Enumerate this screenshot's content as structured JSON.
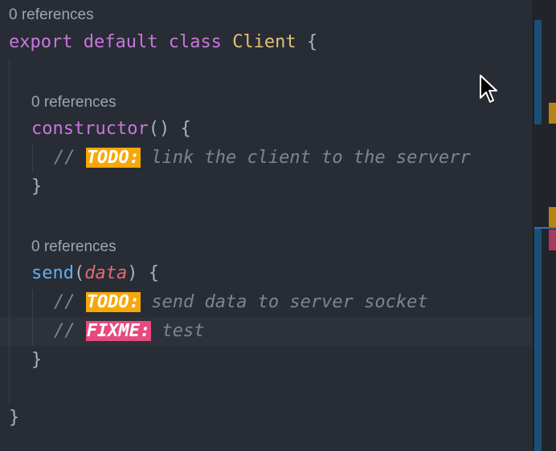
{
  "code_lens": {
    "class_refs": "0 references",
    "constructor_refs": "0 references",
    "send_refs": "0 references"
  },
  "code": {
    "line1": {
      "kw1": "export",
      "kw2": "default",
      "kw3": "class",
      "class_name": "Client",
      "brace": "{"
    },
    "constructor": {
      "name": "constructor",
      "parens": "()",
      "brace": "{"
    },
    "comment1": {
      "slashes": "//",
      "tag": "TODO:",
      "text": "link the client to the serverr"
    },
    "close_brace": "}",
    "send": {
      "name": "send",
      "open": "(",
      "param": "data",
      "close": ")",
      "brace": "{"
    },
    "comment2": {
      "slashes": "//",
      "tag": "TODO:",
      "text": "send data to server socket"
    },
    "comment3": {
      "slashes": "//",
      "tag": "FIXME:",
      "text": "test"
    },
    "class_close": "}"
  },
  "colors": {
    "todo": "#f7a707",
    "fixme": "#e74a7e",
    "keyword": "#c678dd",
    "class": "#e5c07b",
    "function": "#61afef",
    "param": "#e06c75",
    "comment": "#7f848e"
  },
  "icons": {
    "cursor": "mouse-pointer-icon"
  }
}
